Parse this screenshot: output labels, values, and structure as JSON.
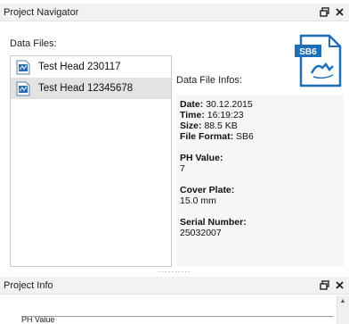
{
  "navigator": {
    "title": "Project Navigator",
    "data_files_label": "Data Files:",
    "data_file_infos_label": "Data File Infos:",
    "files": [
      {
        "name": "Test Head 230117",
        "selected": false
      },
      {
        "name": "Test Head 12345678",
        "selected": true
      }
    ],
    "badge_text": "SB6",
    "info": {
      "date_label": "Date:",
      "date_value": "30.12.2015",
      "time_label": "Time:",
      "time_value": "16:19:23",
      "size_label": "Size:",
      "size_value": "88.5 KB",
      "format_label": "File Format:",
      "format_value": "SB6",
      "ph_label": "PH Value:",
      "ph_value": "7",
      "cover_label": "Cover Plate:",
      "cover_value": "15.0 mm",
      "serial_label": "Serial Number:",
      "serial_value": "25032007"
    }
  },
  "splitter": {
    "dots": "··········"
  },
  "project_info": {
    "title": "Project Info",
    "ph_label": "PH Value"
  },
  "icons": {
    "float": "float-icon",
    "close": "close-icon",
    "file": "data-file-icon"
  },
  "colors": {
    "badge_blue": "#1f6fb7",
    "selected_row": "#e3e3e3",
    "info_bg": "#f6f6f6"
  }
}
